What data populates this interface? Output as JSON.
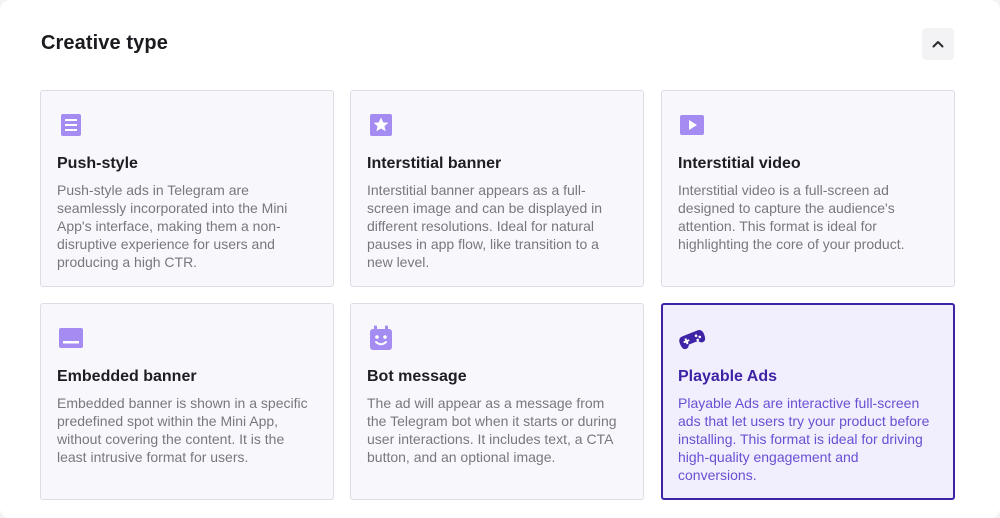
{
  "section": {
    "title": "Creative type",
    "collapse_icon": "chevron-up-icon"
  },
  "colors": {
    "accent": "#3e23a6",
    "icon": "#a58cf2",
    "selected_bg": "#f1effd",
    "card_bg": "#f8f8fc"
  },
  "cards": [
    {
      "icon": "push-list-icon",
      "title": "Push-style",
      "description": "Push-style ads in Telegram are seamlessly incorporated into the Mini App's interface, making them a non-disruptive experience for users and producing a high CTR.",
      "selected": false
    },
    {
      "icon": "star-image-icon",
      "title": "Interstitial banner",
      "description": "Interstitial banner appears as a full-screen image and can be displayed in different resolutions. Ideal for natural pauses in app flow, like transition to a new level.",
      "selected": false
    },
    {
      "icon": "play-video-icon",
      "title": "Interstitial video",
      "description": "Interstitial video is a full-screen ad designed to capture the audience's attention. This format is ideal for highlighting the core of your product.",
      "selected": false
    },
    {
      "icon": "embedded-banner-icon",
      "title": "Embedded banner",
      "description": "Embedded banner is shown in a specific predefined spot within the Mini App, without covering the content. It is the least intrusive format for users.",
      "selected": false
    },
    {
      "icon": "bot-icon",
      "title": "Bot message",
      "description": "The ad will appear as a message from the Telegram bot when it starts or during user interactions. It includes text, a CTA button, and an optional image.",
      "selected": false
    },
    {
      "icon": "gamepad-icon",
      "title": "Playable Ads",
      "description": "Playable Ads are interactive full-screen ads that let users try your product before installing. This format is ideal for driving high-quality engagement and conversions.",
      "selected": true
    }
  ]
}
